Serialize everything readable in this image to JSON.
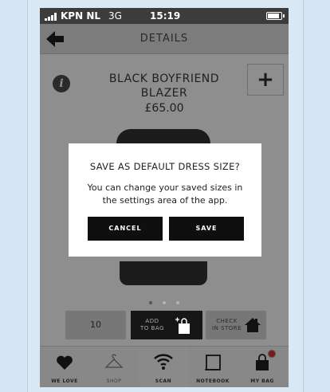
{
  "status_bar": {
    "carrier": "KPN NL",
    "network": "3G",
    "time": "15:19"
  },
  "nav": {
    "title": "DETAILS"
  },
  "product": {
    "name": "BLACK BOYFRIEND BLAZER",
    "price": "£65.00"
  },
  "carousel": {
    "pages": 3,
    "active": 0
  },
  "actions": {
    "quantity": "10",
    "add_to_bag_line1": "ADD",
    "add_to_bag_line2": "TO BAG",
    "check_store_line1": "CHECK",
    "check_store_line2": "IN STORE"
  },
  "tabs": [
    {
      "label": "WE LOVE",
      "icon": "heart-icon"
    },
    {
      "label": "SHOP",
      "icon": "hanger-icon"
    },
    {
      "label": "SCAN",
      "icon": "wifi-scan-icon"
    },
    {
      "label": "NOTEBOOK",
      "icon": "notebook-icon"
    },
    {
      "label": "MY BAG",
      "icon": "bag-icon"
    }
  ],
  "modal": {
    "title": "SAVE AS DEFAULT DRESS SIZE?",
    "body": "You can change your saved sizes in the settings area of the app.",
    "cancel_label": "CANCEL",
    "save_label": "SAVE"
  },
  "colors": {
    "overlay": "#8e8e8e",
    "modal_bg": "#ffffff",
    "button_bg": "#0f0f0f",
    "badge": "#7d1a1a"
  }
}
